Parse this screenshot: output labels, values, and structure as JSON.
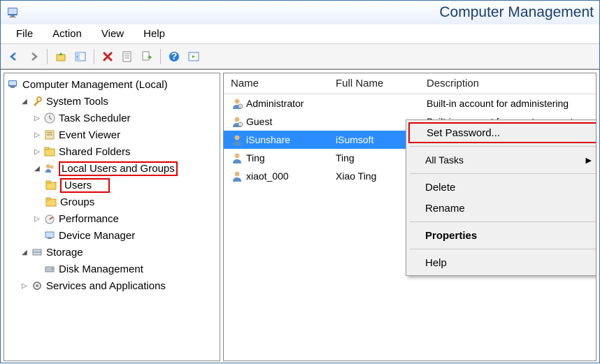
{
  "window": {
    "title": "Computer Management"
  },
  "menu": {
    "file": "File",
    "action": "Action",
    "view": "View",
    "help": "Help"
  },
  "tree": {
    "root": "Computer Management (Local)",
    "system_tools": "System Tools",
    "task_scheduler": "Task Scheduler",
    "event_viewer": "Event Viewer",
    "shared_folders": "Shared Folders",
    "local_users_groups": "Local Users and Groups",
    "users": "Users",
    "groups": "Groups",
    "performance": "Performance",
    "device_manager": "Device Manager",
    "storage": "Storage",
    "disk_management": "Disk Management",
    "services_apps": "Services and Applications"
  },
  "columns": {
    "name": "Name",
    "full_name": "Full Name",
    "description": "Description"
  },
  "users": [
    {
      "name": "Administrator",
      "full_name": "",
      "description": "Built-in account for administering"
    },
    {
      "name": "Guest",
      "full_name": "",
      "description": "Built-in account for guest access to"
    },
    {
      "name": "iSunshare",
      "full_name": "iSumsoft",
      "description": ""
    },
    {
      "name": "Ting",
      "full_name": "Ting",
      "description": ""
    },
    {
      "name": "xiaot_000",
      "full_name": "Xiao Ting",
      "description": ""
    }
  ],
  "context_menu": {
    "set_password": "Set Password...",
    "all_tasks": "All Tasks",
    "delete": "Delete",
    "rename": "Rename",
    "properties": "Properties",
    "help": "Help"
  }
}
